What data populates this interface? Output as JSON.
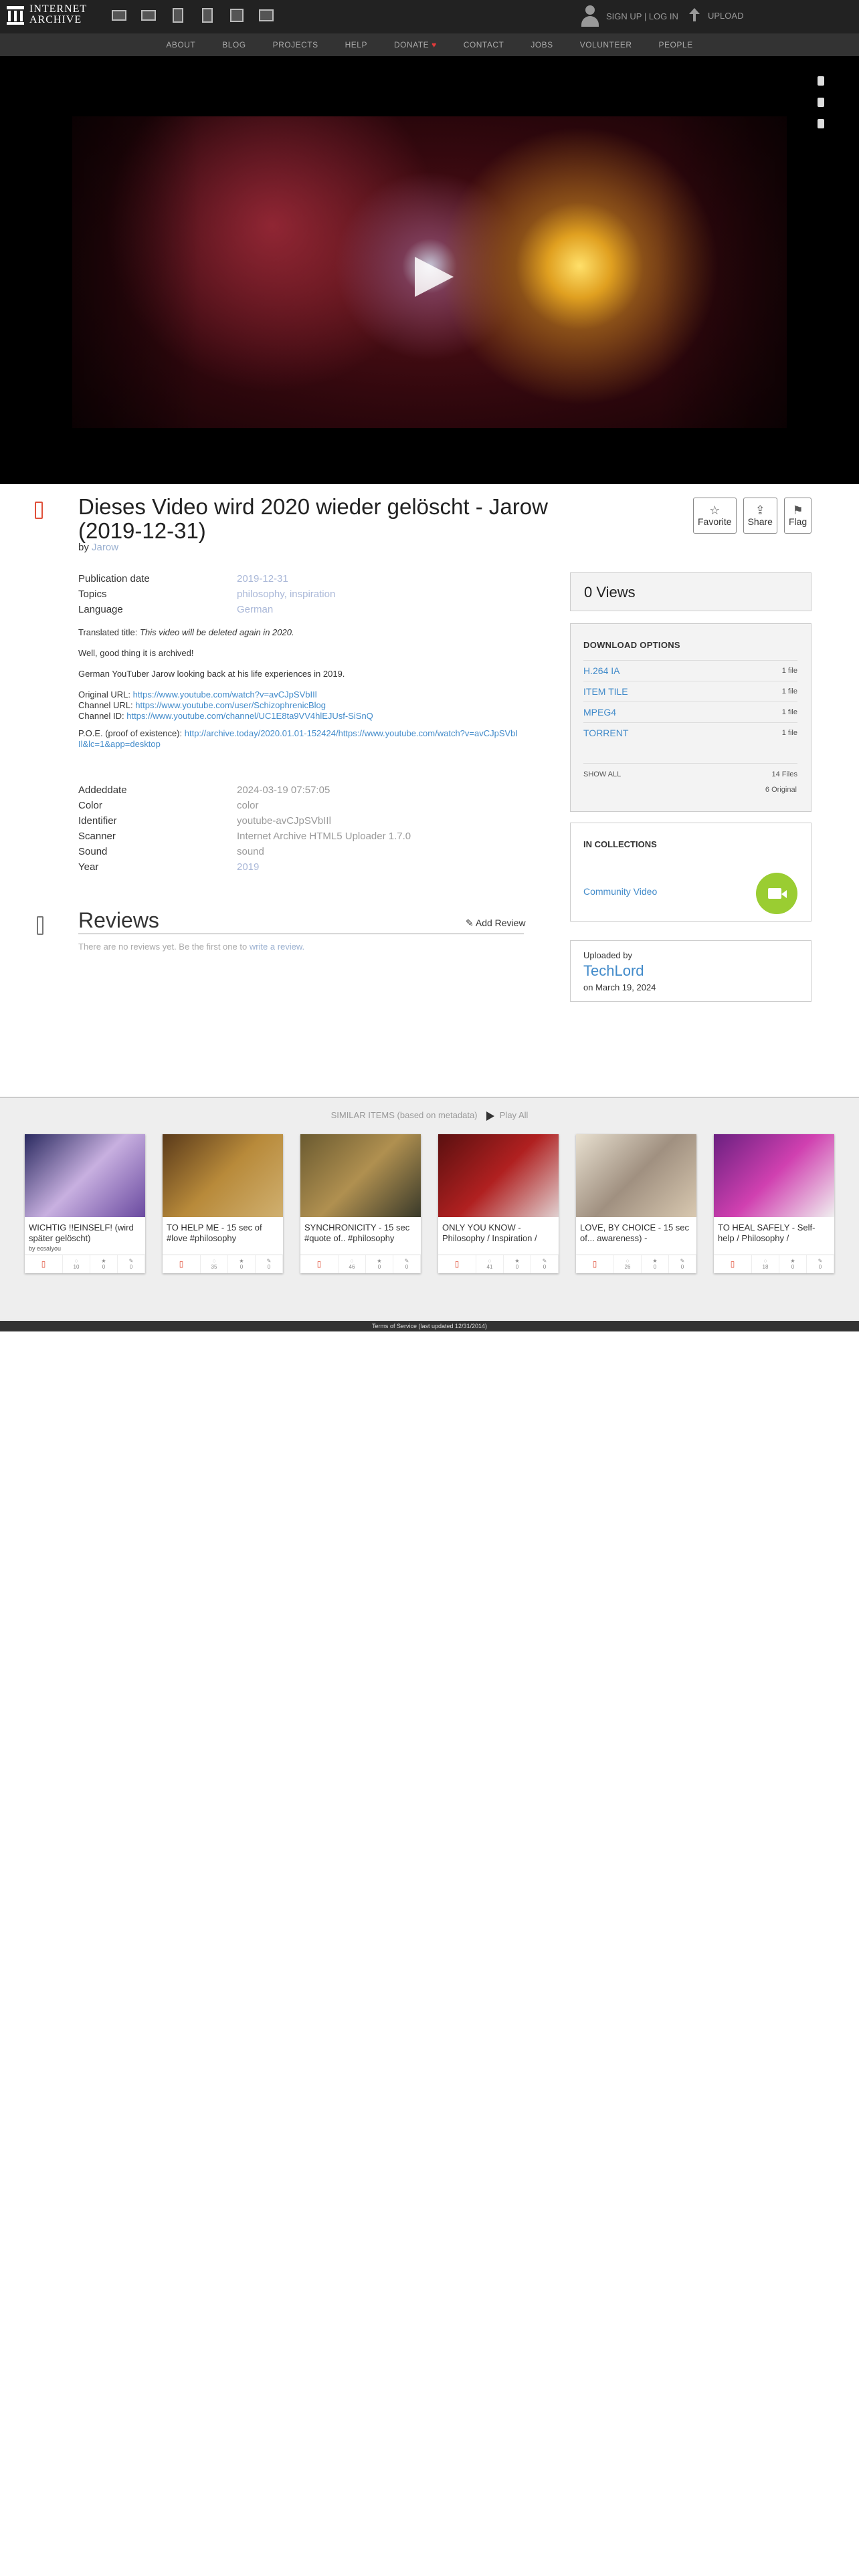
{
  "site": {
    "name_line1": "INTERNET",
    "name_line2": "ARCHIVE"
  },
  "header": {
    "media_icons": [
      "web-icon",
      "texts-icon",
      "video-icon",
      "audio-icon",
      "software-icon",
      "images-icon"
    ],
    "sign_in": "SIGN UP | LOG IN",
    "upload": "UPLOAD"
  },
  "subnav": [
    "ABOUT",
    "BLOG",
    "PROJECTS",
    "HELP",
    "DONATE",
    "CONTACT",
    "JOBS",
    "VOLUNTEER",
    "PEOPLE"
  ],
  "item": {
    "title": "Dieses Video wird 2020 wieder gelöscht - Jarow (2019-12-31)",
    "by_prefix": "by",
    "creator": "Jarow",
    "metadata": [
      {
        "k": "Publication date",
        "v": "2019-12-31"
      },
      {
        "k": "Topics",
        "v": "philosophy, inspiration"
      },
      {
        "k": "Language",
        "v": "German"
      }
    ],
    "description": {
      "translated_label": "Translated title:",
      "translated_title": "This video will be deleted again in 2020.",
      "line1": "Well, good thing it is archived!",
      "line2": "German YouTuber Jarow looking back at his life experiences in 2019.",
      "original_url_label": "Original URL:",
      "original_url": "https://www.youtube.com/watch?v=avCJpSVbIIl",
      "channel_url_label": "Channel URL:",
      "channel_url": "https://www.youtube.com/user/SchizophrenicBlog",
      "channel_id_label": "Channel ID:",
      "channel_id": "https://www.youtube.com/channel/UC1E8ta9VV4hlEJUsf-SiSnQ",
      "poe_label": "P.O.E. (proof of existence):",
      "poe_url": "http://archive.today/2020.01.01-152424/https://www.youtube.com/watch?v=avCJpSVbIIl&lc=1&app=desktop"
    },
    "extra_metadata": [
      {
        "k": "Addeddate",
        "v": "2024-03-19 07:57:05"
      },
      {
        "k": "Color",
        "v": "color"
      },
      {
        "k": "Identifier",
        "v": "youtube-avCJpSVbIIl"
      },
      {
        "k": "Scanner",
        "v": "Internet Archive HTML5 Uploader 1.7.0"
      },
      {
        "k": "Sound",
        "v": "sound"
      },
      {
        "k": "Year",
        "v": "2019"
      }
    ]
  },
  "actions": {
    "favorite": "Favorite",
    "share": "Share",
    "flag": "Flag"
  },
  "reviews": {
    "title": "Reviews",
    "add": "Add Review",
    "empty": "There are no reviews yet. Be the first one to",
    "write_link": "write a review."
  },
  "views": "0 Views",
  "downloads": {
    "head": "DOWNLOAD OPTIONS",
    "rows": [
      {
        "fmt": "H.264 IA",
        "count": "1 file"
      },
      {
        "fmt": "ITEM TILE",
        "count": "1 file"
      },
      {
        "fmt": "MPEG4",
        "count": "1 file"
      },
      {
        "fmt": "TORRENT",
        "count": "1 file"
      }
    ],
    "show_all": "SHOW ALL",
    "total_files": "14 Files",
    "original": "6 Original"
  },
  "collections": {
    "head": "IN COLLECTIONS",
    "name": "Community Video"
  },
  "uploader": {
    "label": "Uploaded by",
    "name": "TechLord",
    "date": "on March 19, 2024"
  },
  "similar": {
    "head": "SIMILAR ITEMS (based on metadata)",
    "play_all": "Play All",
    "tiles": [
      {
        "title": "WICHTIG !!EINSELF! (wird später gelöscht)",
        "by": "by ecsaIyou",
        "views": "10",
        "favs": "0",
        "reviews": "0",
        "colors": [
          "#2a2a60",
          "#c8b0e0",
          "#6a4aa0"
        ]
      },
      {
        "title": "TO HELP ME - 15 sec of #love #philosophy",
        "by": "",
        "views": "35",
        "favs": "0",
        "reviews": "0",
        "colors": [
          "#5a3a1a",
          "#b88a3a",
          "#d0b070"
        ]
      },
      {
        "title": "SYNCHRONICITY - 15 sec #quote of.. #philosophy",
        "by": "",
        "views": "46",
        "favs": "0",
        "reviews": "0",
        "colors": [
          "#6a5a30",
          "#b09050",
          "#3a3a2a"
        ]
      },
      {
        "title": "ONLY YOU KNOW - Philosophy / Inspiration /",
        "by": "",
        "views": "41",
        "favs": "0",
        "reviews": "0",
        "colors": [
          "#5a1010",
          "#b02020",
          "#e0d0d0"
        ]
      },
      {
        "title": "LOVE, BY CHOICE - 15 sec of... awareness) -",
        "by": "",
        "views": "26",
        "favs": "0",
        "reviews": "0",
        "colors": [
          "#e8e0d0",
          "#a09080",
          "#d8c8b0"
        ]
      },
      {
        "title": "TO HEAL SAFELY - Self-help / Philosophy /",
        "by": "",
        "views": "18",
        "favs": "0",
        "reviews": "0",
        "colors": [
          "#6a2080",
          "#d040b0",
          "#f0f0f0"
        ]
      }
    ]
  },
  "footer": "Terms of Service (last updated 12/31/2014)"
}
